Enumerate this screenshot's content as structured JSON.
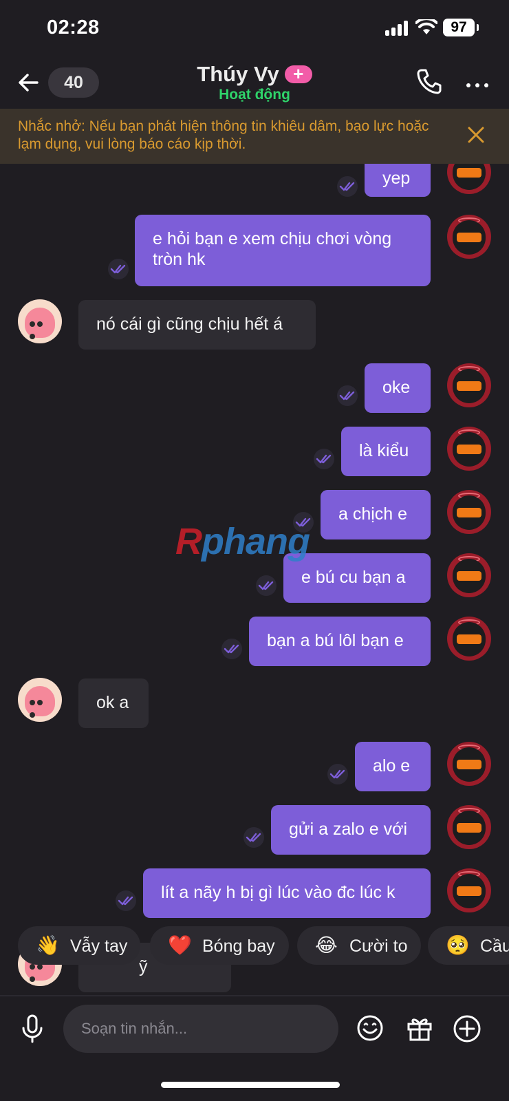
{
  "status_bar": {
    "time": "02:28",
    "battery": "97"
  },
  "header": {
    "unread_count": "40",
    "contact_name": "Thúy Vy",
    "badge": "+",
    "presence": "Hoạt động"
  },
  "banner": {
    "text": "Nhắc nhở: Nếu bạn phát hiện thông tin khiêu dâm, bạo lực hoặc lạm dụng, vui lòng báo cáo kịp thời."
  },
  "messages": [
    {
      "sender": "me",
      "text": "yep"
    },
    {
      "sender": "me",
      "text": "e hỏi bạn e xem chịu chơi vòng tròn hk"
    },
    {
      "sender": "them",
      "text": "nó cái gì cũng chịu hết á"
    },
    {
      "sender": "me",
      "text": "oke"
    },
    {
      "sender": "me",
      "text": "là kiểu"
    },
    {
      "sender": "me",
      "text": "a chịch e"
    },
    {
      "sender": "me",
      "text": "e bú cu bạn a"
    },
    {
      "sender": "me",
      "text": "bạn a bú lôl bạn e"
    },
    {
      "sender": "them",
      "text": "ok a"
    },
    {
      "sender": "me",
      "text": "alo e"
    },
    {
      "sender": "me",
      "text": "gửi a zalo e với"
    },
    {
      "sender": "me",
      "text": "lít a nãy h bị gì lúc vào đc lúc k"
    },
    {
      "sender": "them",
      "text": "ỹ"
    }
  ],
  "watermark": {
    "part1": "R",
    "part2": "phang"
  },
  "reactions": [
    {
      "emoji": "👋",
      "label": "Vẫy tay"
    },
    {
      "emoji": "❤️",
      "label": "Bóng bay"
    },
    {
      "emoji": "😂",
      "label": "Cười to"
    },
    {
      "emoji": "🥺",
      "label": "Cầu"
    }
  ],
  "composer": {
    "placeholder": "Soạn tin nhắn..."
  },
  "colors": {
    "sent_bubble": "#7d5ed8",
    "received_bubble": "#2e2c32",
    "presence": "#2fd36a",
    "banner_text": "#d99a2f",
    "badge": "#f25ca8"
  }
}
